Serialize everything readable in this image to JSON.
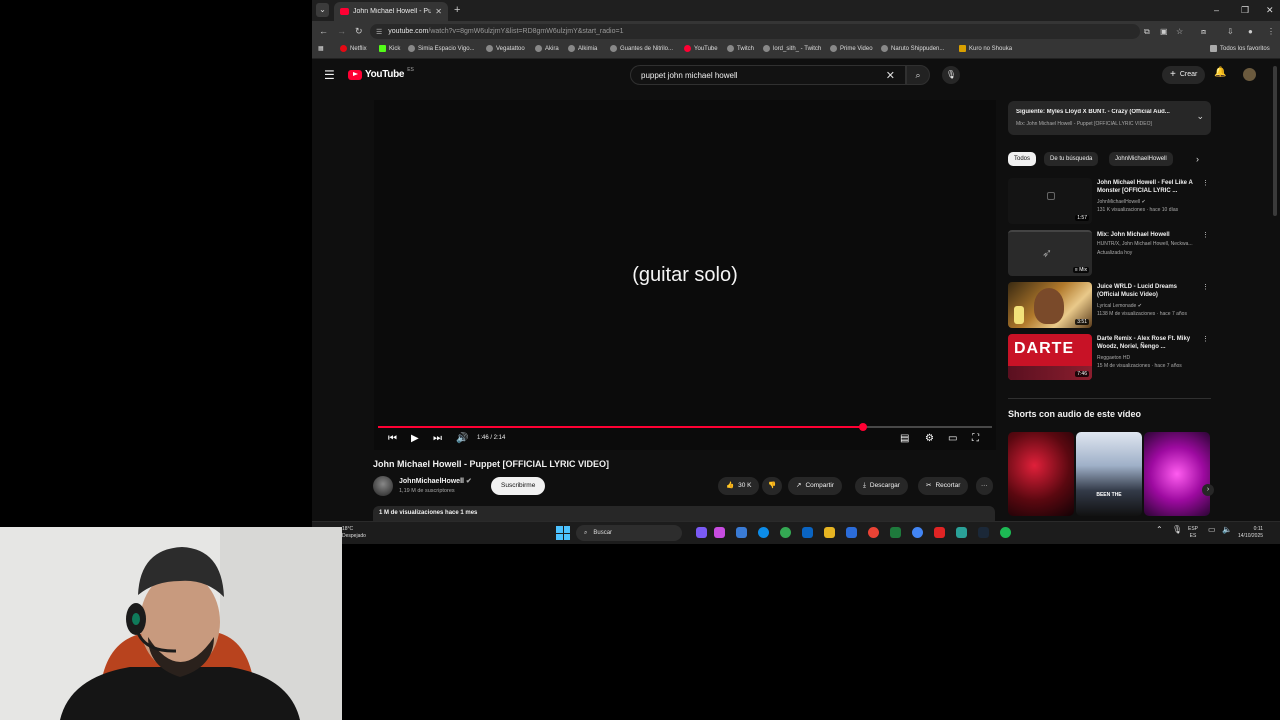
{
  "browser": {
    "tab_title": "John Michael Howell - Puppet [",
    "url_domain": "youtube.com",
    "url_path": "/watch?v=8gmW6ulzjmY&list=RD8gmW6ulzjmY&start_radio=1",
    "bookmarks": [
      "Netflix",
      "Kick",
      "Simia Espacio Vigo...",
      "Vegatattoo",
      "Akira",
      "Alkimia",
      "Guantes de Nitrilo...",
      "YouTube",
      "Twitch",
      "lord_sith_ - Twitch",
      "Prime Video",
      "Naruto Shippuden...",
      "Kuro no Shouka"
    ],
    "all_bookmarks": "Todos los favoritos"
  },
  "youtube": {
    "logo": "YouTube",
    "country": "ES",
    "search_query": "puppet john michael howell",
    "create_label": "Crear",
    "player": {
      "caption": "(guitar solo)",
      "time": "1:46 / 2:14",
      "progress": 0.79
    },
    "video": {
      "title": "John Michael Howell - Puppet [OFFICIAL LYRIC VIDEO]",
      "channel": "JohnMichaelHowell",
      "subscribers": "1,19 M de suscriptores",
      "subscribe": "Suscribirme",
      "likes": "30 K",
      "share": "Compartir",
      "download": "Descargar",
      "clip": "Recortar",
      "views_date": "1 M de visualizaciones  hace 1 mes"
    },
    "up_next": {
      "title": "Siguiente: Myles Lloyd X BUNT. - Crazy (Official Aud...",
      "subtitle": "Mix: John Michael Howell - Puppet [OFFICIAL LYRIC VIDEO]"
    },
    "chips": [
      "Todos",
      "De tu búsqueda",
      "JohnMichaelHowell"
    ],
    "related": [
      {
        "title": "John Michael Howell - Feel Like A Monster [OFFICIAL LYRIC ...",
        "channel": "JohnMichaelHowell",
        "meta": "131 K visualizaciones · hace 10 días",
        "duration": "1:57"
      },
      {
        "title": "Mix: John Michael Howell",
        "channel": "HUNTR/X, John Michael Howell, Neckwa...",
        "meta": "Actualizada hoy",
        "duration": "Mix"
      },
      {
        "title": "Juice WRLD - Lucid Dreams (Official Music Video)",
        "channel": "Lyrical Lemonade",
        "meta": "1138 M de visualizaciones · hace 7 años",
        "duration": "3:51"
      },
      {
        "title": "Darte Remix - Alex Rose Ft. Miky Woodz, Noriel, Ñengo ...",
        "channel": "Reggaeton HD",
        "meta": "15 M de visualizaciones · hace 7 años",
        "duration": "7:46"
      }
    ],
    "darte_thumb_text": "DARTE",
    "shorts_title": "Shorts con audio de este vídeo",
    "short_caption": "BEEN THE"
  },
  "taskbar": {
    "weather_temp": "18°C",
    "weather_desc": "Despejado",
    "search": "Buscar",
    "lang_top": "ESP",
    "lang_bottom": "ES",
    "time": "0:11",
    "date": "14/10/2025"
  },
  "colors": {
    "accent": "#ff0033",
    "background": "#0f0f0f",
    "surface": "#272727"
  }
}
